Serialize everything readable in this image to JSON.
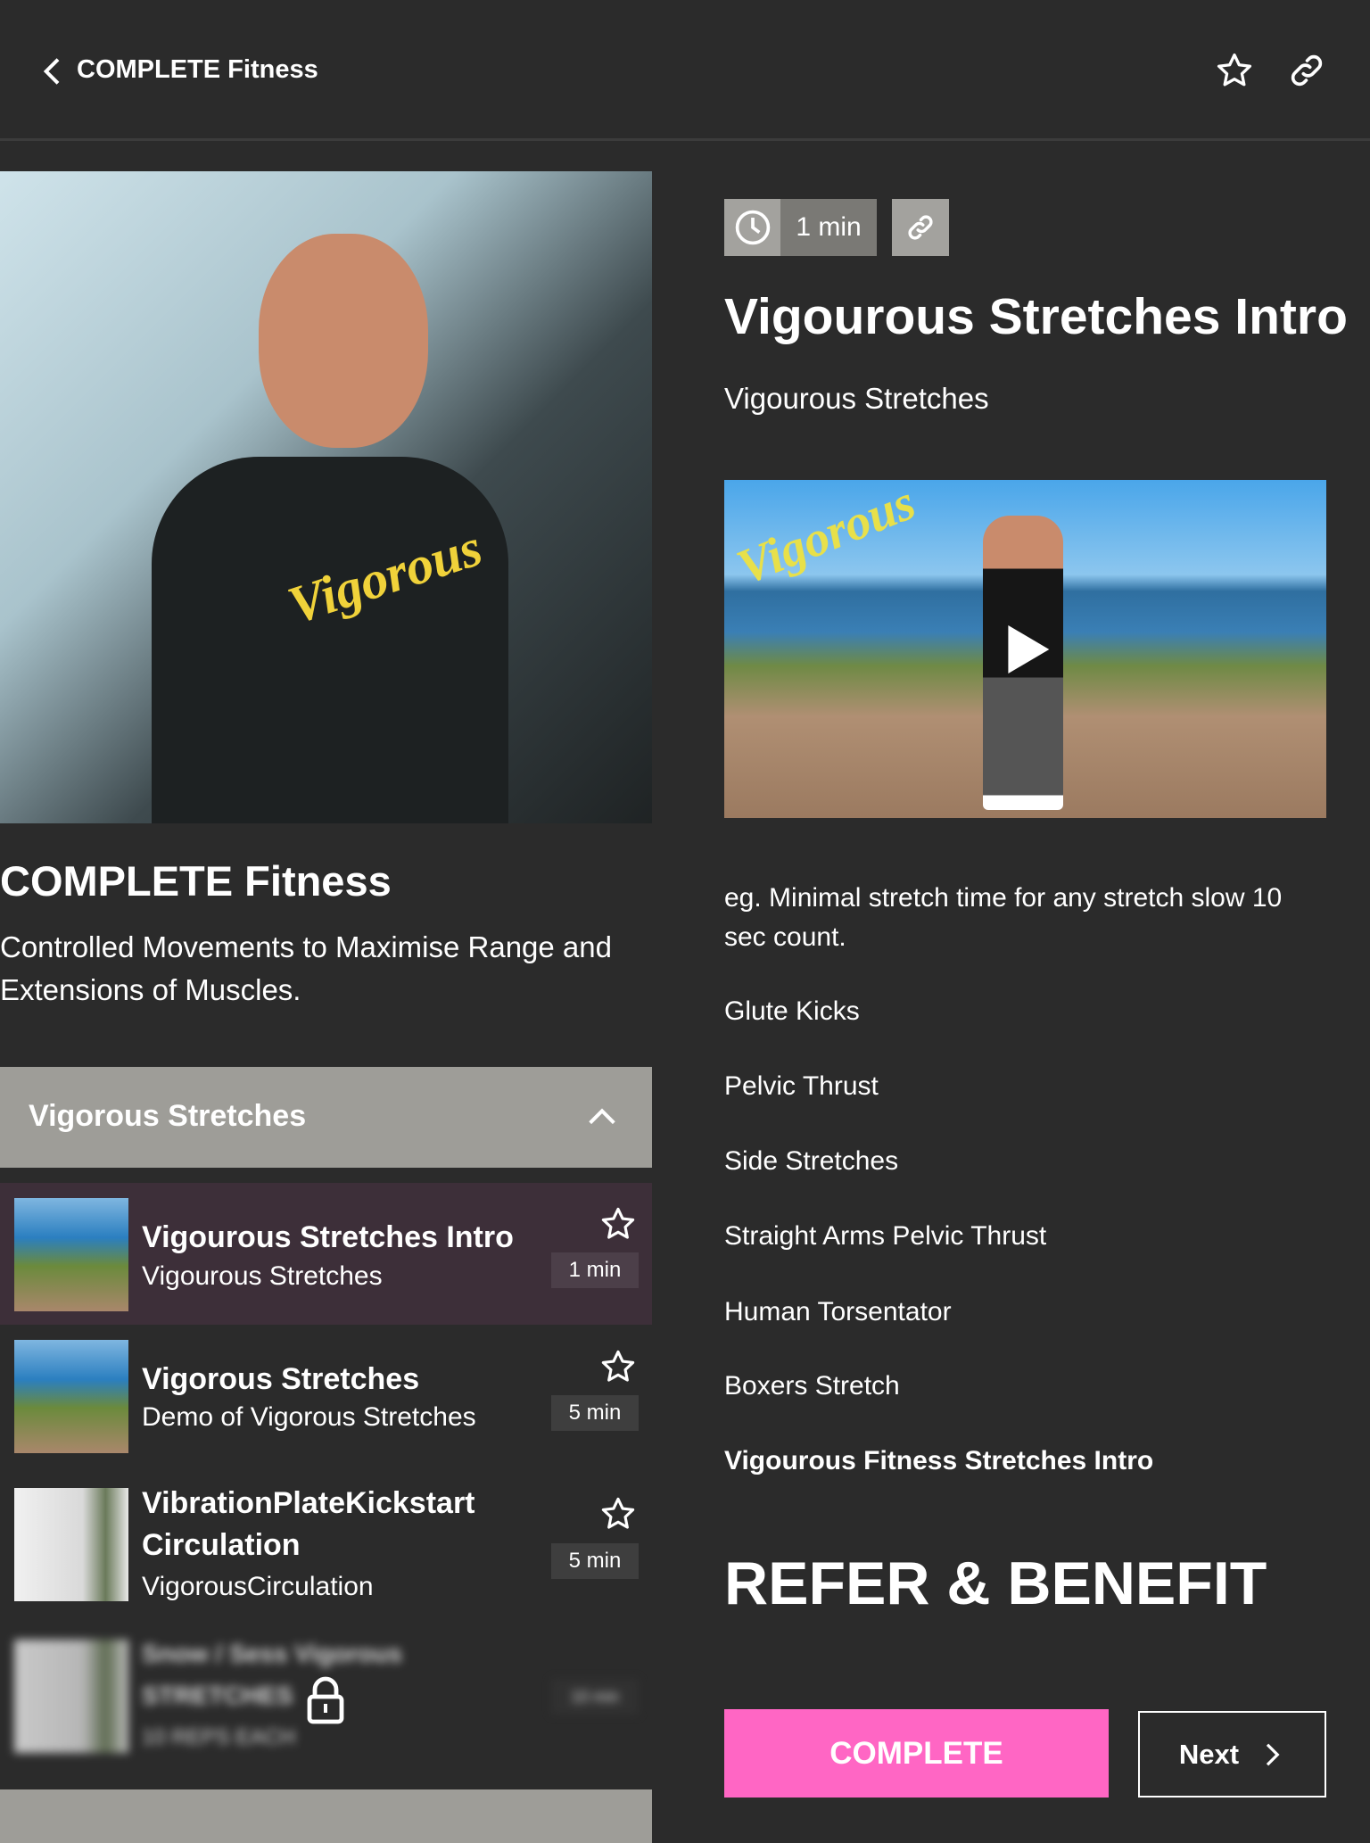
{
  "header": {
    "title": "COMPLETE Fitness",
    "back_icon": "chevron-left-icon",
    "favorite_icon": "star-outline-icon",
    "share_icon": "link-icon"
  },
  "course": {
    "title": "COMPLETE Fitness",
    "description": "Controlled Movements to Maximise Range and Extensions of Muscles."
  },
  "section": {
    "title": "Vigorous Stretches",
    "expanded": true
  },
  "lessons": [
    {
      "title": "Vigourous Stretches Intro",
      "subtitle": "Vigourous Stretches",
      "duration": "1 min",
      "selected": true
    },
    {
      "title": "Vigorous Stretches",
      "subtitle": "Demo of Vigorous Stretches",
      "duration": "5 min"
    },
    {
      "title": "VibrationPlateKickstart Circulation",
      "subtitle": "VigorousCirculation",
      "duration": "5 min"
    },
    {
      "title": "Snow / Sess Vigorous STRETCHES",
      "subtitle": "10 REPS EACH",
      "duration": "10 min",
      "locked": true
    }
  ],
  "lesson": {
    "duration": "1 min",
    "title": "Vigourous Stretches Intro",
    "subtitle": "Vigourous Stretches",
    "description": "eg. Minimal stretch time for any stretch slow 10 sec count.",
    "items": [
      "Glute Kicks",
      "Pelvic Thrust",
      "Side Stretches",
      "Straight Arms Pelvic Thrust",
      "Human Torsentator",
      "Boxers Stretch"
    ],
    "bold_item": "Vigourous Fitness Stretches Intro",
    "promo": "REFER & BENEFIT",
    "complete_label": "COMPLETE",
    "next_label": "Next"
  },
  "colors": {
    "background": "#2b2b2b",
    "accent": "#ff66c4",
    "section": "#9e9d98",
    "selected": "#3d2f39"
  }
}
